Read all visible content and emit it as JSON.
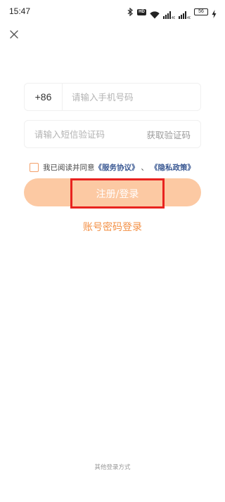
{
  "status_bar": {
    "time": "15:47",
    "hd_label": "HD",
    "battery": "56"
  },
  "close": {
    "icon": "close-icon"
  },
  "phone": {
    "country_code": "+86",
    "placeholder": "请输入手机号码"
  },
  "sms": {
    "placeholder": "请输入短信验证码",
    "get_code_label": "获取验证码"
  },
  "agreement": {
    "prefix": "我已阅读并同意",
    "service_link": "《服务协议》",
    "separator": "、",
    "privacy_link": "《隐私政策》",
    "checked": false
  },
  "login_button": {
    "label": "注册/登录"
  },
  "password_login": {
    "label": "账号密码登录"
  },
  "other_methods": {
    "label": "其他登录方式"
  },
  "colors": {
    "accent": "#f39046",
    "button_bg": "#fcc9a3",
    "link": "#3c5a94",
    "highlight": "#e8231f"
  }
}
